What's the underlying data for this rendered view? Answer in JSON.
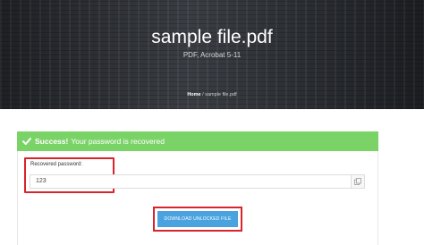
{
  "hero": {
    "title": "sample file.pdf",
    "subtitle": "PDF, Acrobat 5-11",
    "breadcrumb_home": "Home",
    "breadcrumb_sep": " / ",
    "breadcrumb_current": "sample file.pdf"
  },
  "alert": {
    "strong": "Success!",
    "message": "Your password is recovered",
    "color": "#7ad367"
  },
  "field": {
    "label": "Recovered password:",
    "value": "123"
  },
  "download": {
    "label": "DOWNLOAD UNLOCKED FILE",
    "color": "#4aa3df"
  },
  "highlight_color": "#d9232d",
  "icons": {
    "alert": "check-icon",
    "copy": "copy-icon"
  }
}
